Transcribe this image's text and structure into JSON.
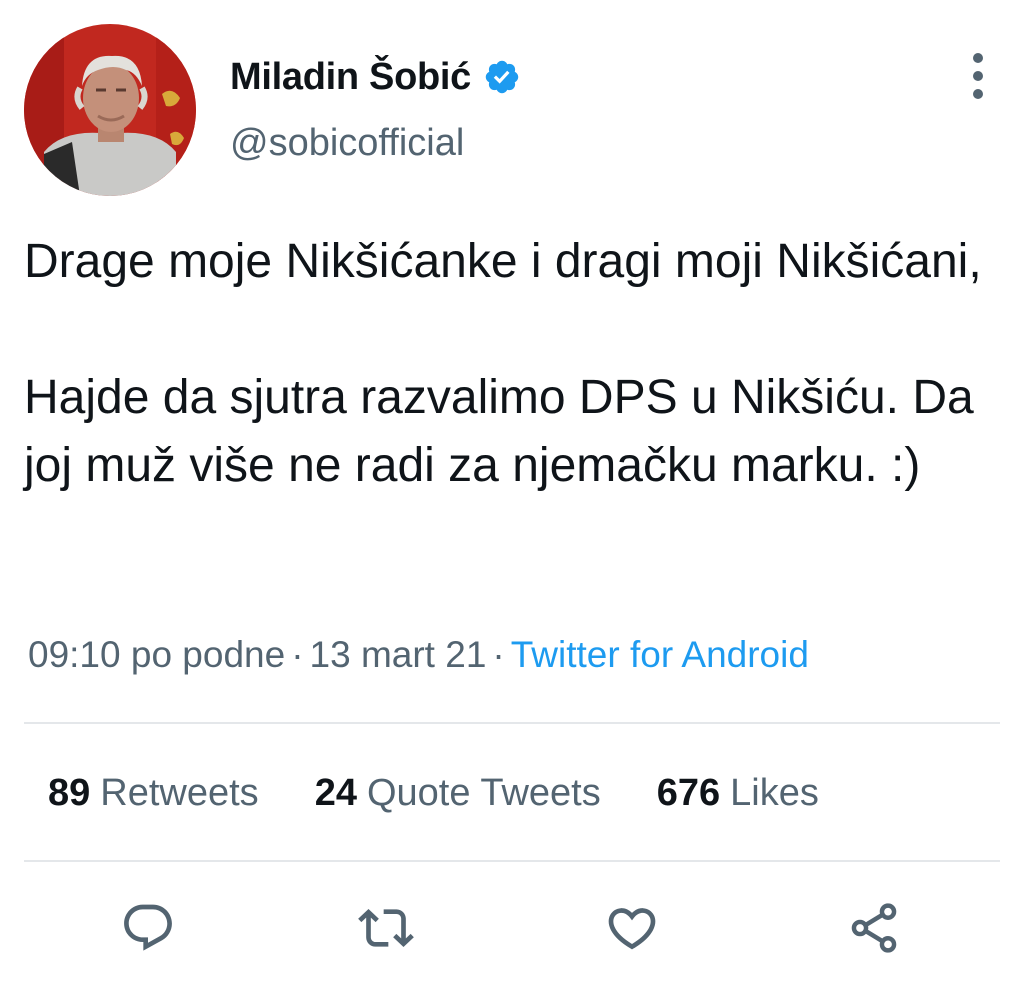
{
  "user": {
    "display_name": "Miladin Šobić",
    "handle": "@sobicofficial",
    "verified_icon": "verified-badge-icon",
    "avatar_icon": "profile-photo"
  },
  "tweet": {
    "lines": [
      "Drage moje Nikšićanke i dragi moji Nikšićani,",
      "Hajde da sjutra razvalimo DPS u Nikšiću. Da joj muž više ne radi za njemačku marku. :)"
    ],
    "time": "09:10 po podne",
    "date": "13 mart 21",
    "source": "Twitter for Android",
    "separator": "·"
  },
  "stats": {
    "retweets_count": "89",
    "retweets_label": "Retweets",
    "quotes_count": "24",
    "quotes_label": "Quote Tweets",
    "likes_count": "676",
    "likes_label": "Likes"
  },
  "actions": [
    "reply-icon",
    "retweet-icon",
    "like-icon",
    "share-icon"
  ],
  "colors": {
    "accent": "#1d9bf0",
    "text": "#0f1419",
    "secondary": "#536471",
    "divider": "#e4e7ea"
  }
}
